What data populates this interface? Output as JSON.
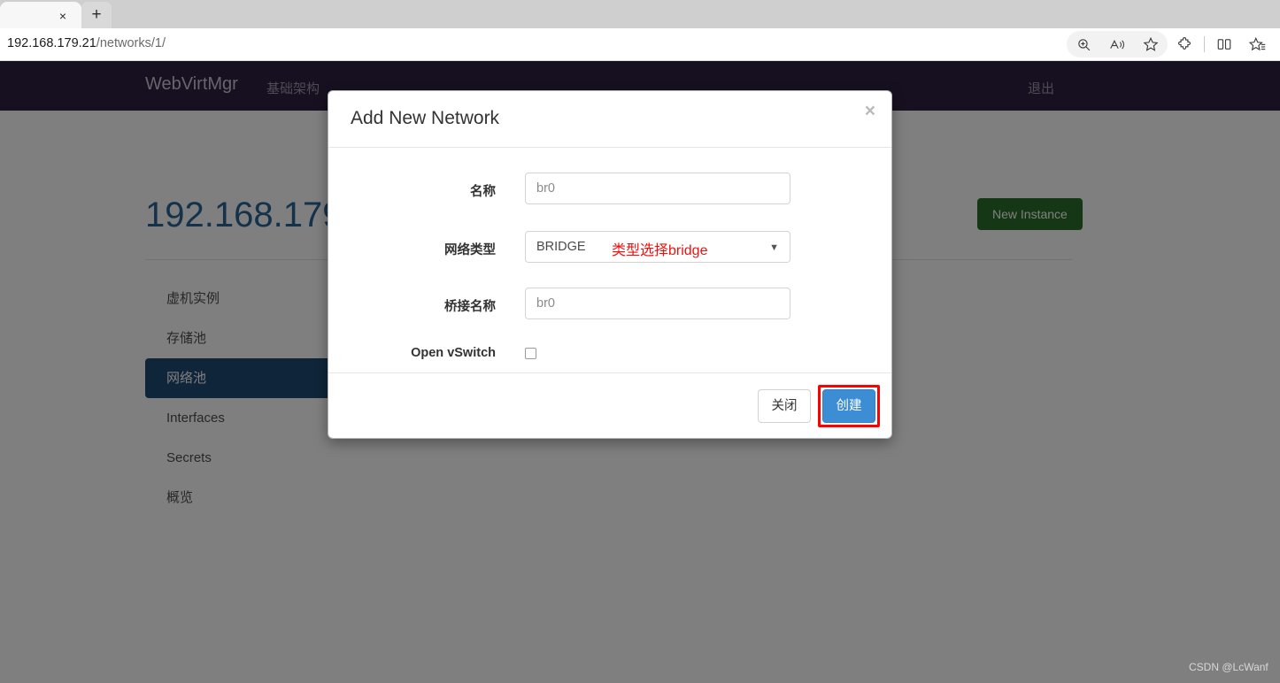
{
  "browser": {
    "tab": {
      "title": "",
      "close_label": "×"
    },
    "new_tab_label": "+",
    "address": {
      "host": "192.168.179.21",
      "path": "/networks/1/",
      "full": "192.168.179.21/networks/1/"
    },
    "toolbar_icons": [
      "zoom-icon",
      "read-aloud-icon",
      "favorite-star-icon",
      "extensions-puzzle-icon",
      "split-screen-icon",
      "collections-icon"
    ]
  },
  "navbar": {
    "brand": "WebVirtMgr",
    "infrastructure": "基础架构",
    "logout": "退出",
    "background": "#2f2040"
  },
  "page": {
    "title": "192.168.179",
    "new_instance_button": "New Instance",
    "new_instance_color": "#2a6e2a",
    "sidebar": [
      {
        "label": "虚机实例",
        "active": false
      },
      {
        "label": "存储池",
        "active": false
      },
      {
        "label": "网络池",
        "active": true
      },
      {
        "label": "Interfaces",
        "active": false
      },
      {
        "label": "Secrets",
        "active": false
      },
      {
        "label": "概览",
        "active": false
      }
    ],
    "sidebar_active_color": "#1e4a72",
    "watermark": "CSDN @LcWanf"
  },
  "modal": {
    "title": "Add New Network",
    "close_label": "×",
    "fields": {
      "name": {
        "label": "名称",
        "value": "br0"
      },
      "network_type": {
        "label": "网络类型",
        "value": "BRIDGE",
        "annotation": "类型选择bridge",
        "annotation_color": "#ee1111"
      },
      "bridge_name": {
        "label": "桥接名称",
        "value": "br0"
      },
      "open_vswitch": {
        "label": "Open vSwitch",
        "checked": false
      }
    },
    "buttons": {
      "close": "关闭",
      "create": "创建",
      "create_color": "#3c8dd4",
      "highlight_color": "#ff0000"
    }
  }
}
